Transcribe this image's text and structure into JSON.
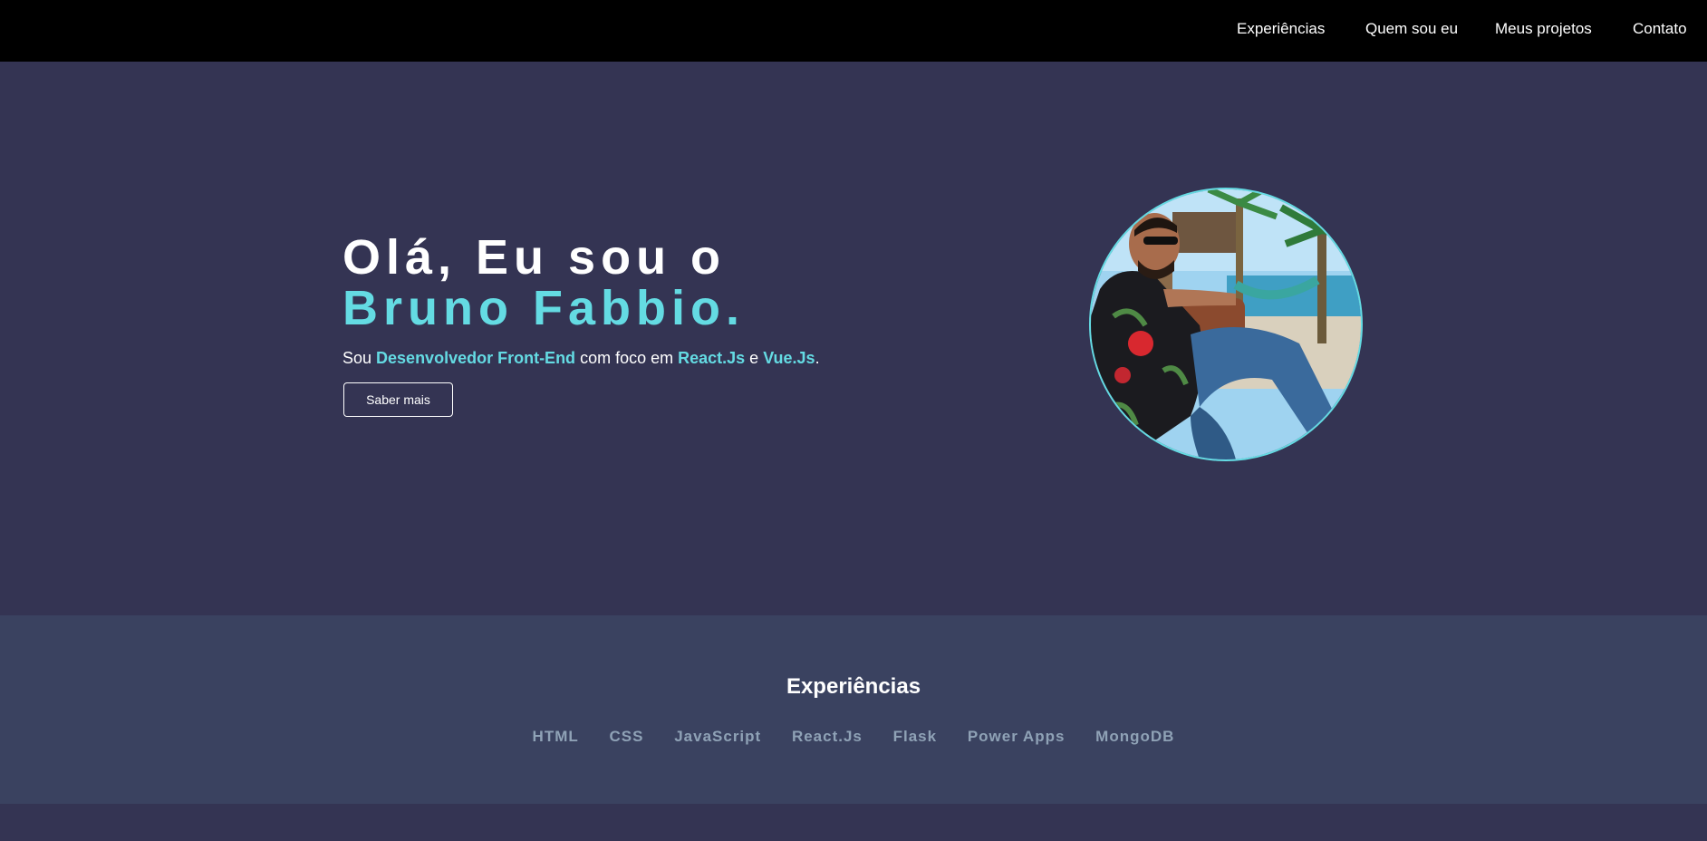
{
  "nav": {
    "items": [
      {
        "label": "Experiências"
      },
      {
        "label": "Quem sou eu"
      },
      {
        "label": "Meus projetos"
      },
      {
        "label": "Contato"
      }
    ]
  },
  "hero": {
    "title_line1": "Olá, Eu sou o",
    "title_line2": "Bruno Fabbio.",
    "subtitle": {
      "prefix": "Sou ",
      "role": "Desenvolvedor Front-End",
      "middle": " com foco em ",
      "tech1": "React.Js",
      "connector": " e ",
      "tech2": "Vue.Js",
      "suffix": "."
    },
    "button_label": "Saber mais",
    "avatar_icon": "profile-photo"
  },
  "skills": {
    "title": "Experiências",
    "items": [
      "HTML",
      "CSS",
      "JavaScript",
      "React.Js",
      "Flask",
      "Power Apps",
      "MongoDB"
    ]
  },
  "colors": {
    "nav_bg": "#000000",
    "hero_bg": "#343453",
    "accent": "#64dbe3",
    "skills_bg": "#3a4260",
    "skills_text": "#8fa2b6"
  }
}
